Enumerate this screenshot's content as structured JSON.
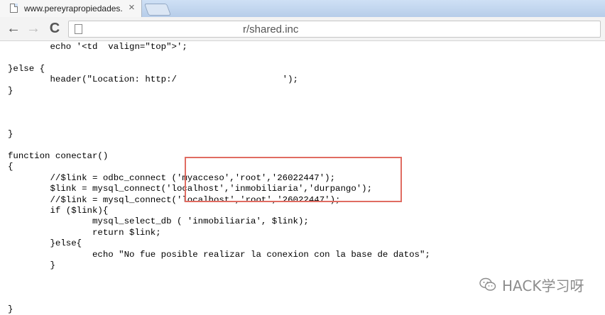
{
  "browser": {
    "tab_title": "www.pereyrapropiedades.",
    "tab_close": "×",
    "address": "r/shared.inc",
    "nav": {
      "back": "←",
      "forward": "→",
      "reload": "C"
    }
  },
  "code_lines": [
    "        echo '<td  valign=\"top\">';",
    "",
    "}else {",
    "        header(\"Location: http:/                    ');",
    "}",
    "",
    "",
    "",
    "}",
    "",
    "function conectar()",
    "{",
    "        //$link = odbc_connect ('myacceso','root','26022447');",
    "        $link = mysql_connect('localhost','inmobiliaria','durpango');",
    "        //$link = mysql_connect('localhost','root','26022447');",
    "        if ($link){",
    "                mysql_select_db ( 'inmobiliaria', $link);",
    "                return $link;",
    "        }else{",
    "                echo \"No fue posible realizar la conexion con la base de datos\";",
    "        }",
    "",
    "",
    "",
    "}"
  ],
  "watermark": {
    "text": "HACK学习呀",
    "icon": "wechat-icon"
  },
  "colors": {
    "highlight": "#e06c62",
    "watermark": "#8c8c8c"
  }
}
